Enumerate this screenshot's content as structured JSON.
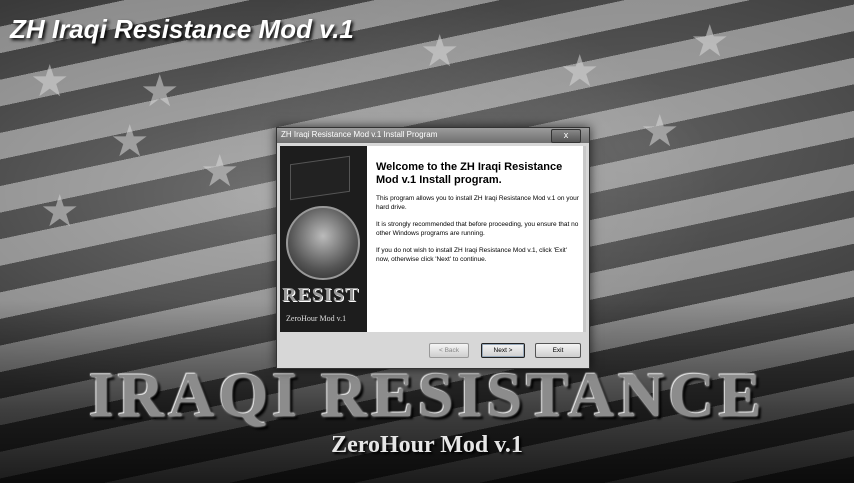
{
  "app_title": "ZH Iraqi Resistance Mod v.1",
  "banner": {
    "title": "IRAQI RESISTANCE",
    "subtitle": "ZeroHour Mod v.1"
  },
  "dialog": {
    "window_title": "ZH Iraqi Resistance Mod v.1 Install Program",
    "close_label": "x",
    "side_image": {
      "logo_text": "RESIST",
      "sub_text": "ZeroHour Mod v.1"
    },
    "welcome_heading": "Welcome to the ZH Iraqi Resistance Mod v.1 Install program.",
    "paragraphs": [
      "This program allows you to install ZH Iraqi Resistance Mod v.1 on your hard drive.",
      "It is strongly recommended that before proceeding, you ensure that no other Windows programs are running.",
      "If you do not wish to install ZH Iraqi Resistance Mod v.1, click 'Exit' now, otherwise click 'Next' to continue."
    ],
    "buttons": {
      "back": "< Back",
      "next": "Next >",
      "exit": "Exit"
    }
  }
}
